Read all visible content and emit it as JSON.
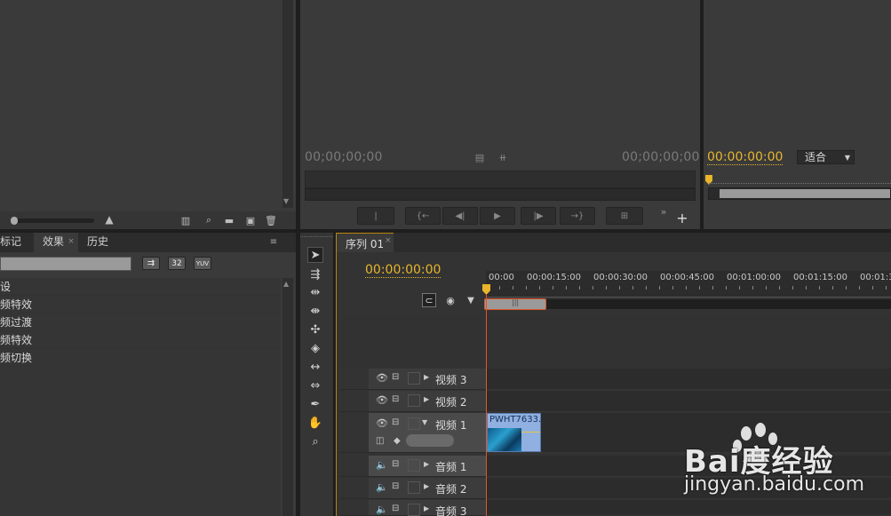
{
  "top_left_panel": {},
  "source_monitor": {
    "timecode_in": "00;00;00;00",
    "timecode_out": "00;00;00;00"
  },
  "program_monitor": {
    "timecode": "00:00:00:00",
    "zoom_select": "适合"
  },
  "effects_panel": {
    "tabs": [
      "标记",
      "效果",
      "历史"
    ],
    "preset_icons": [
      "32",
      "YUV"
    ],
    "items": [
      "预设",
      "音频特效",
      "音频过渡",
      "视频特效",
      "视频切换"
    ]
  },
  "timeline": {
    "tab_label": "序列 01",
    "timecode": "00:00:00:00",
    "ruler_ticks": [
      "00:00",
      "00:00:15:00",
      "00:00:30:00",
      "00:00:45:00",
      "00:01:00:00",
      "00:01:15:00",
      "00:01:3"
    ],
    "tracks": [
      {
        "name": "视频 3",
        "type": "video"
      },
      {
        "name": "视频 2",
        "type": "video"
      },
      {
        "name": "视频 1",
        "type": "video",
        "expanded": true
      },
      {
        "name": "音频 1",
        "type": "audio"
      },
      {
        "name": "音频 2",
        "type": "audio"
      },
      {
        "name": "音频 3",
        "type": "audio"
      }
    ],
    "clip_name": "PWHT7633."
  },
  "watermark": {
    "brand": "Bai度经验",
    "url": "jingyan.baidu.com"
  },
  "colors": {
    "accent_timecode": "#e8b52b",
    "playhead": "#e0562a",
    "clip": "#8fb0e0"
  }
}
